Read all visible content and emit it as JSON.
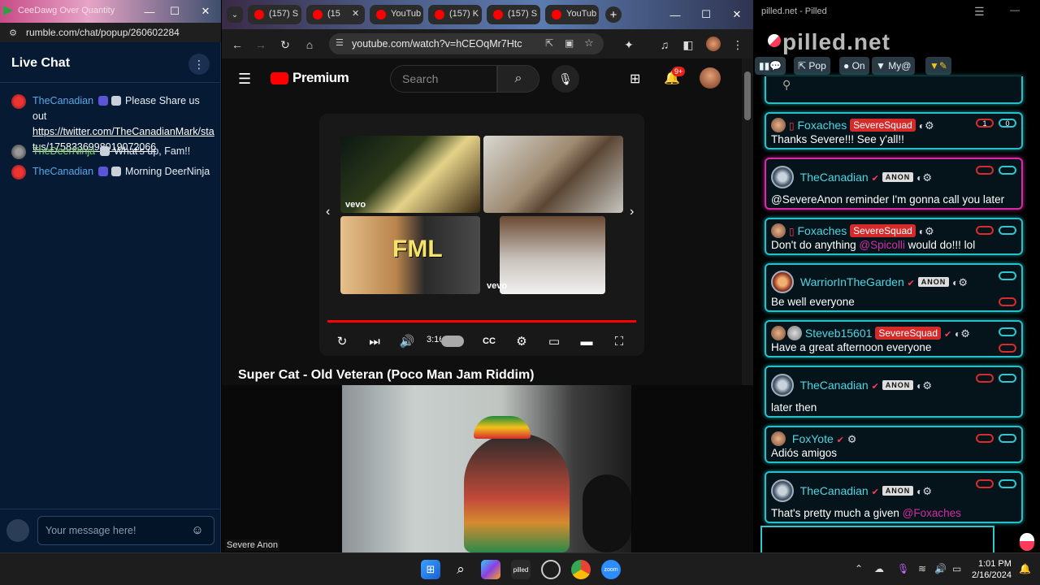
{
  "rumble": {
    "window_title": "CeeDawg Over Quantity",
    "url": "rumble.com/chat/popup/260602284",
    "chat_title": "Live Chat",
    "messages": [
      {
        "user": "TheCanadian",
        "text": "Please Share us out",
        "link": "https://twitter.com/TheCanadianMark/status/1758336998019072066"
      },
      {
        "user": "TheDeerNinja",
        "text": "What's up, Fam!!"
      },
      {
        "user": "TheCanadian",
        "text": "Morning DeerNinja"
      }
    ],
    "input_placeholder": "Your message here!"
  },
  "chrome": {
    "tabs": [
      {
        "label": "(157) S"
      },
      {
        "label": "(15"
      },
      {
        "label": "YouTub"
      },
      {
        "label": "(157) K"
      },
      {
        "label": "(157) S"
      },
      {
        "label": "YouTub"
      }
    ],
    "url": "youtube.com/watch?v=hCEOqMr7Htc"
  },
  "youtube": {
    "logo_text": "Premium",
    "search_placeholder": "Search",
    "notifications": "9+",
    "time": "3:16",
    "video_title": "Super Cat - Old Veteran (Poco Man Jam Riddim)",
    "vevo": "vevo",
    "thumb_text": "FML"
  },
  "cam": {
    "label": "Severe Anon"
  },
  "pilled": {
    "window_title": "pilled.net - Pilled",
    "brand": "pilled.net",
    "toolbar": {
      "pop": "Pop",
      "on": "On",
      "my": "My@"
    },
    "anon_badge": "ANON",
    "messages": [
      {
        "user": "Foxaches",
        "badge": "SevereSquad",
        "text": "Thanks Severe!!! See y'all!!",
        "count1": "1",
        "count2": "0"
      },
      {
        "user": "TheCanadian",
        "text": "@SevereAnon reminder I'm gonna call you later"
      },
      {
        "user": "Foxaches",
        "badge": "SevereSquad",
        "text_before": "Don't do anything ",
        "mention": "@Spicolli",
        "text_after": " would do!!! lol"
      },
      {
        "user": "WarriorInTheGarden",
        "text": "Be well everyone"
      },
      {
        "user": "Steveb15601",
        "badge": "SevereSquad",
        "text": "Have a great afternoon everyone"
      },
      {
        "user": "TheCanadian",
        "text": "later then"
      },
      {
        "user": "FoxYote",
        "text": "Adiós amigos"
      },
      {
        "user": "TheCanadian",
        "text_before": "That's pretty much a given ",
        "mention": "@Foxaches"
      }
    ]
  },
  "taskbar": {
    "time": "1:01 PM",
    "date": "2/16/2024"
  },
  "colors": {
    "rumble_bg": "#061a33",
    "pilled_cyan": "#26c0c8",
    "pilled_pink": "#d62ca3",
    "youtube_red": "#ff0000"
  }
}
